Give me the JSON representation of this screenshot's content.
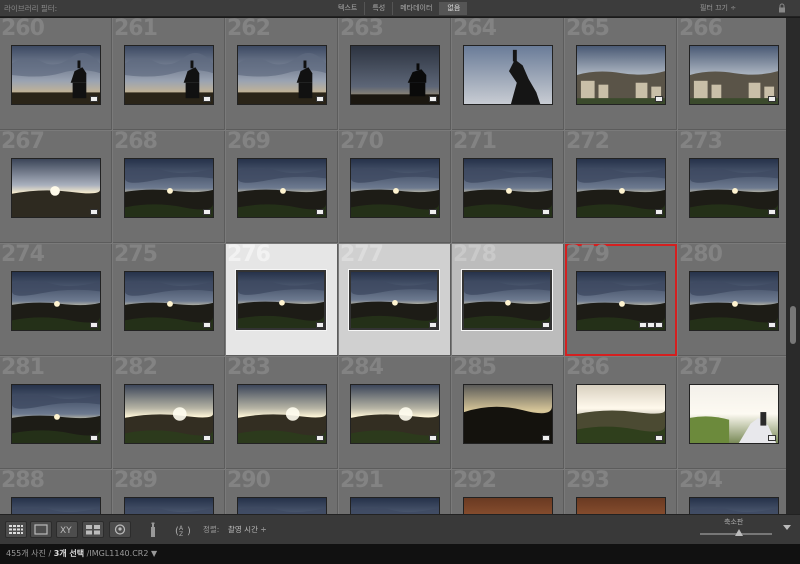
{
  "filter_bar": {
    "label": "라이브러리 필터:",
    "tabs": [
      {
        "label": "텍스트",
        "active": false
      },
      {
        "label": "특성",
        "active": false
      },
      {
        "label": "메타데이터",
        "active": false
      },
      {
        "label": "없음",
        "active": true
      }
    ],
    "preset": "필터 끄기 ÷"
  },
  "grid": {
    "cells": [
      {
        "num": "260",
        "scene": "statue",
        "badges": 1
      },
      {
        "num": "261",
        "scene": "statue",
        "badges": 1
      },
      {
        "num": "262",
        "scene": "statue",
        "badges": 1
      },
      {
        "num": "263",
        "scene": "statue-dark",
        "badges": 1
      },
      {
        "num": "264",
        "scene": "statue-big",
        "badges": 0
      },
      {
        "num": "265",
        "scene": "town",
        "badges": 1
      },
      {
        "num": "266",
        "scene": "town",
        "badges": 1
      },
      {
        "num": "267",
        "scene": "sunset-bright",
        "badges": 1
      },
      {
        "num": "268",
        "scene": "dusk",
        "badges": 1
      },
      {
        "num": "269",
        "scene": "dusk",
        "badges": 1
      },
      {
        "num": "270",
        "scene": "dusk",
        "badges": 1
      },
      {
        "num": "271",
        "scene": "dusk",
        "badges": 1
      },
      {
        "num": "272",
        "scene": "dusk",
        "badges": 1
      },
      {
        "num": "273",
        "scene": "dusk",
        "badges": 1
      },
      {
        "num": "274",
        "scene": "dusk",
        "badges": 1
      },
      {
        "num": "275",
        "scene": "dusk",
        "badges": 1
      },
      {
        "num": "276",
        "scene": "dusk",
        "badges": 1,
        "selection": "a"
      },
      {
        "num": "277",
        "scene": "dusk",
        "badges": 1,
        "selection": "b"
      },
      {
        "num": "278",
        "scene": "dusk",
        "badges": 1,
        "selection": "c"
      },
      {
        "num": "279",
        "scene": "dusk",
        "badges": 3,
        "active": true
      },
      {
        "num": "280",
        "scene": "dusk",
        "badges": 1
      },
      {
        "num": "281",
        "scene": "dusk",
        "badges": 1
      },
      {
        "num": "282",
        "scene": "glow",
        "badges": 1
      },
      {
        "num": "283",
        "scene": "glow",
        "badges": 1
      },
      {
        "num": "284",
        "scene": "glow",
        "badges": 1
      },
      {
        "num": "285",
        "scene": "dark-hill",
        "badges": 1
      },
      {
        "num": "286",
        "scene": "bright",
        "badges": 1
      },
      {
        "num": "287",
        "scene": "couple",
        "badges": 1
      },
      {
        "num": "288",
        "scene": "dusk",
        "badges": 0
      },
      {
        "num": "289",
        "scene": "dusk",
        "badges": 0
      },
      {
        "num": "290",
        "scene": "dusk",
        "badges": 0
      },
      {
        "num": "291",
        "scene": "dusk",
        "badges": 0
      },
      {
        "num": "292",
        "scene": "warm",
        "badges": 0
      },
      {
        "num": "293",
        "scene": "warm",
        "badges": 0
      },
      {
        "num": "294",
        "scene": "dusk",
        "badges": 0
      }
    ]
  },
  "toolbar": {
    "sort_label": "정렬:",
    "sort_value": "촬영 시간 ÷",
    "thumbnail_label": "축소판"
  },
  "status": {
    "count": "455개 사진",
    "selected": "3개 선택",
    "filename": "/IMGL1140.CR2 ▼"
  },
  "colors": {
    "active_outline": "#d42020",
    "grid_bg": "#7a7a7a",
    "cell_bg": "#6f6f6f"
  }
}
